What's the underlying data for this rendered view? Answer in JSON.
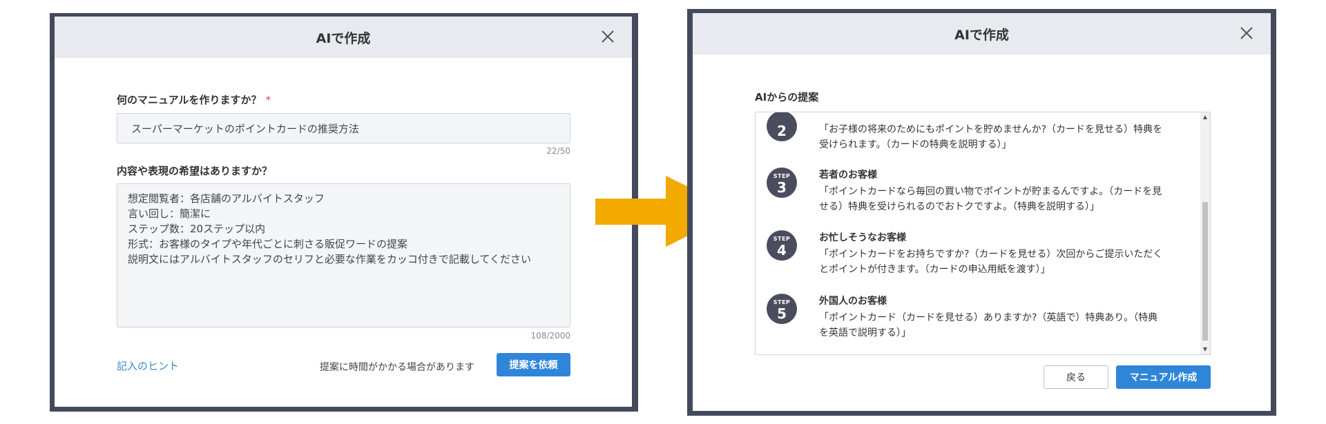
{
  "left_dialog": {
    "title": "AIで作成",
    "question1": "何のマニュアルを作りますか？",
    "required_mark": "*",
    "input_value": "スーパーマーケットのポイントカードの推奨方法",
    "input_counter": "22/50",
    "question2": "内容や表現の希望はありますか？",
    "textarea_lines": [
      "想定閲覧者：各店舗のアルバイトスタッフ",
      "言い回し：簡潔に",
      "ステップ数：20ステップ以内",
      "形式：お客様のタイプや年代ごとに刺さる販促ワードの提案",
      "説明文にはアルバイトスタッフのセリフと必要な作業をカッコ付きで記載してください"
    ],
    "textarea_counter": "108/2000",
    "hint_link": "記入のヒント",
    "note": "提案に時間がかかる場合があります",
    "submit_button": "提案を依頼"
  },
  "right_dialog": {
    "title": "AIで作成",
    "section_title": "AIからの提案",
    "step_caption": "STEP",
    "steps": [
      {
        "number": "2",
        "title": "",
        "lines": [
          "「お子様の将来のためにもポイントを貯めませんか?（カードを見せる）特典を",
          "受けられます。（カードの特典を説明する）」"
        ]
      },
      {
        "number": "3",
        "title": "若者のお客様",
        "lines": [
          "「ポイントカードなら毎回の買い物でポイントが貯まるんですよ。（カードを見",
          "せる）特典を受けられるのでおトクですよ。（特典を説明する）」"
        ]
      },
      {
        "number": "4",
        "title": "お忙しそうなお客様",
        "lines": [
          "「ポイントカードをお持ちですか?（カードを見せる）次回からご提示いただく",
          "とポイントが付きます。（カードの申込用紙を渡す）」"
        ]
      },
      {
        "number": "5",
        "title": "外国人のお客様",
        "lines": [
          "「ポイントカード（カードを見せる）ありますか?（英語で）特典あり。（特典",
          "を英語で説明する）」"
        ]
      }
    ],
    "back_button": "戻る",
    "create_button": "マニュアル作成"
  },
  "colors": {
    "accent": "#2f86d8",
    "frame": "#444a5c",
    "header": "#e8eaef",
    "arrow": "#f2a900",
    "badge": "#4a4d5e",
    "required": "#e0454b"
  }
}
